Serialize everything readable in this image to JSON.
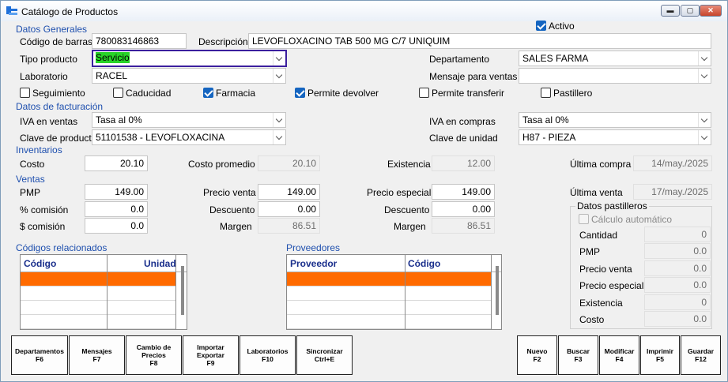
{
  "window": {
    "title": "Catálogo de Productos",
    "min": "▬",
    "max": "▢",
    "close": "✕"
  },
  "activo": {
    "label": "Activo",
    "checked": true
  },
  "datos_generales": {
    "section": "Datos Generales",
    "codigo_barras_label": "Código de barras",
    "codigo_barras": "780083146863",
    "descripcion_label": "Descripción",
    "descripcion": "LEVOFLOXACINO TAB 500 MG C/7 UNIQUIM",
    "tipo_producto_label": "Tipo producto",
    "tipo_producto": "Servicio",
    "laboratorio_label": "Laboratorio",
    "laboratorio": "RACEL",
    "departamento_label": "Departamento",
    "departamento": "SALES FARMA",
    "mensaje_label": "Mensaje para ventas",
    "mensaje": ""
  },
  "checks": {
    "seguimiento": "Seguimiento",
    "caducidad": "Caducidad",
    "farmacia": "Farmacia",
    "permite_devolver": "Permite devolver",
    "permite_transferir": "Permite transferir",
    "pastillero": "Pastillero"
  },
  "facturacion": {
    "section": "Datos de facturación",
    "iva_ventas_label": "IVA en ventas",
    "iva_ventas": "Tasa al 0%",
    "iva_compras_label": "IVA en compras",
    "iva_compras": "Tasa al 0%",
    "clave_producto_label": "Clave de producto",
    "clave_producto": "51101538 - LEVOFLOXACINA",
    "clave_unidad_label": "Clave de unidad",
    "clave_unidad": "H87 - PIEZA"
  },
  "inventarios": {
    "section": "Inventarios",
    "costo_label": "Costo",
    "costo": "20.10",
    "costo_promedio_label": "Costo promedio",
    "costo_promedio": "20.10",
    "existencia_label": "Existencia",
    "existencia": "12.00",
    "ultima_compra_label": "Última compra",
    "ultima_compra": "14/may./2025"
  },
  "ventas": {
    "section": "Ventas",
    "pmp_label": "PMP",
    "pmp": "149.00",
    "precio_venta_label": "Precio venta",
    "precio_venta": "149.00",
    "precio_especial_label": "Precio especial",
    "precio_especial": "149.00",
    "ultima_venta_label": "Última venta",
    "ultima_venta": "17/may./2025",
    "comision_pct_label": "% comisión",
    "comision_pct": "0.0",
    "descuento_label": "Descuento",
    "descuento1": "0.00",
    "descuento2": "0.00",
    "comision_amt_label": "$ comisión",
    "comision_amt": "0.0",
    "margen_label": "Margen",
    "margen1": "86.51",
    "margen2": "86.51"
  },
  "pastilleros": {
    "title": "Datos pastilleros",
    "calculo": "Cálculo automático",
    "cantidad_label": "Cantidad",
    "cantidad": "0",
    "pmp_label": "PMP",
    "pmp": "0.0",
    "precio_venta_label": "Precio venta",
    "precio_venta": "0.0",
    "precio_especial_label": "Precio especial",
    "precio_especial": "0.0",
    "existencia_label": "Existencia",
    "existencia": "0",
    "costo_label": "Costo",
    "costo": "0.0"
  },
  "codigos_relacionados": {
    "section": "Códigos relacionados",
    "col1": "Código",
    "col2": "Unidad"
  },
  "proveedores": {
    "section": "Proveedores",
    "col1": "Proveedor",
    "col2": "Código"
  },
  "buttons": {
    "departamentos": [
      "Departamentos",
      "F6"
    ],
    "mensajes": [
      "Mensajes",
      "F7"
    ],
    "cambio_precios": [
      "Cambio de",
      "Precios",
      "F8"
    ],
    "importar": [
      "Importar",
      "Exportar",
      "F9"
    ],
    "laboratorios": [
      "Laboratorios",
      "F10"
    ],
    "sincronizar": [
      "Sincronizar",
      "Ctrl+E"
    ],
    "nuevo": [
      "Nuevo",
      "F2"
    ],
    "buscar": [
      "Buscar",
      "F3"
    ],
    "modificar": [
      "Modificar",
      "F4"
    ],
    "imprimir": [
      "Imprimir",
      "F5"
    ],
    "guardar": [
      "Guardar",
      "F12"
    ]
  },
  "colors": {
    "accent": "#1e4fae",
    "selected_row": "#ff6a00",
    "highlight": "#28d428",
    "focus_border": "#3b1f9e"
  }
}
